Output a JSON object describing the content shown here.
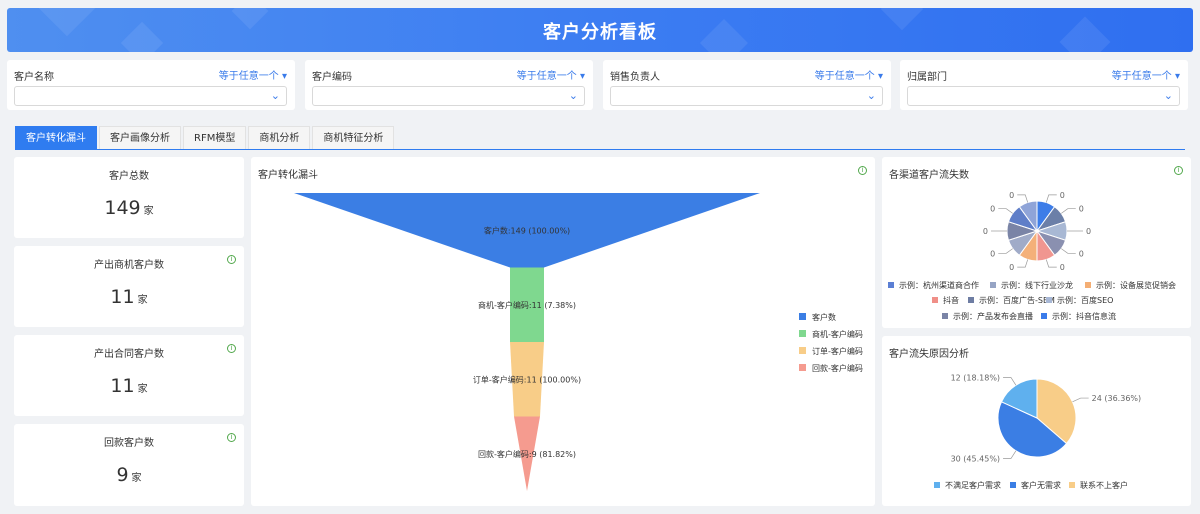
{
  "header": {
    "title": "客户分析看板"
  },
  "filters": [
    {
      "label": "客户名称",
      "op": "等于任意一个"
    },
    {
      "label": "客户编码",
      "op": "等于任意一个"
    },
    {
      "label": "销售负责人",
      "op": "等于任意一个"
    },
    {
      "label": "归属部门",
      "op": "等于任意一个"
    }
  ],
  "tabs": [
    "客户转化漏斗",
    "客户画像分析",
    "RFM模型",
    "商机分析",
    "商机特征分析"
  ],
  "stats": [
    {
      "title": "客户总数",
      "value": "149",
      "unit": "家"
    },
    {
      "title": "产出商机客户数",
      "value": "11",
      "unit": "家"
    },
    {
      "title": "产出合同客户数",
      "value": "11",
      "unit": "家"
    },
    {
      "title": "回款客户数",
      "value": "9",
      "unit": "家"
    }
  ],
  "funnel": {
    "title": "客户转化漏斗"
  },
  "churn_channel": {
    "title": "各渠道客户流失数"
  },
  "churn_reason": {
    "title": "客户流失原因分析"
  },
  "icons": {
    "info": "info-icon",
    "chevron": "chevron-down-icon",
    "caret": "caret-down-icon"
  },
  "chart_data": [
    {
      "type": "funnel",
      "title": "客户转化漏斗",
      "categories": [
        "客户数",
        "商机-客户编码",
        "订单-客户编码",
        "回款-客户编码"
      ],
      "values": [
        149,
        11,
        11,
        9
      ],
      "labels": [
        "客户数:149 (100.00%)",
        "商机-客户编码:11 (7.38%)",
        "订单-客户编码:11 (100.00%)",
        "回款-客户编码:9 (81.82%)"
      ],
      "colors": [
        "#3b7ee4",
        "#7fd88f",
        "#f8cd88",
        "#f59b8f"
      ],
      "legend": "right"
    },
    {
      "type": "pie",
      "title": "各渠道客户流失数",
      "values": [
        0,
        0,
        0,
        0,
        0,
        0,
        0,
        0,
        0,
        0
      ],
      "slice_labels": [
        "0",
        "0",
        "0",
        "0",
        "0",
        "0",
        "0",
        "0",
        "0",
        "0"
      ],
      "colors": [
        "#3d7de8",
        "#6b7fa8",
        "#a8b8d4",
        "#8a90b0",
        "#f09690",
        "#f4b079",
        "#a0abc8",
        "#7a84a6",
        "#5f7ec8",
        "#8fa4d8"
      ],
      "legend_rows": [
        [
          {
            "name": "示例：杭州渠道商合作",
            "color": "#5b7fd4"
          },
          {
            "name": "示例：线下行业沙龙",
            "color": "#96a4c4"
          },
          {
            "name": "示例：设备展览促销会",
            "color": "#f4ae74"
          }
        ],
        [
          {
            "name": "抖音",
            "color": "#f08f88"
          },
          {
            "name": "示例：百度广告-SEM",
            "color": "#6e7da3"
          },
          {
            "name": "示例：百度SEO",
            "color": "#a8b8d6"
          }
        ],
        [
          {
            "name": "示例：产品发布会直播",
            "color": "#7a84a6"
          },
          {
            "name": "示例：抖音信息流",
            "color": "#3a7bea"
          }
        ]
      ],
      "legend": "bottom"
    },
    {
      "type": "pie",
      "title": "客户流失原因分析",
      "categories": [
        "不满足客户需求",
        "客户无需求",
        "联系不上客户"
      ],
      "values": [
        12,
        30,
        24
      ],
      "labels": [
        "12 (18.18%)",
        "30 (45.45%)",
        "24 (36.36%)"
      ],
      "colors": [
        "#5fb0ee",
        "#3b7ee4",
        "#f8cd88"
      ],
      "legend": "bottom"
    }
  ]
}
